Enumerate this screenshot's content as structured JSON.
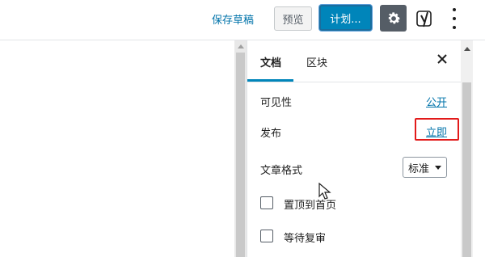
{
  "toolbar": {
    "save_draft_label": "保存草稿",
    "preview_label": "预览",
    "schedule_label": "计划...",
    "settings_icon": "gear-icon",
    "yoast_icon": "yoast-icon",
    "more_icon": "more-vertical-icon"
  },
  "sidebar": {
    "tabs": [
      {
        "label": "文档",
        "active": true
      },
      {
        "label": "区块",
        "active": false
      }
    ],
    "close_icon": "close-icon",
    "visibility": {
      "label": "可见性",
      "value": "公开"
    },
    "publish": {
      "label": "发布",
      "value": "立即"
    },
    "post_format": {
      "label": "文章格式",
      "selected": "标准"
    },
    "sticky": {
      "label": "置顶到首页",
      "checked": false
    },
    "pending_review": {
      "label": "等待复审",
      "checked": false
    }
  },
  "colors": {
    "accent": "#0085ba",
    "link": "#0073aa",
    "highlight": "#e21a1a"
  }
}
